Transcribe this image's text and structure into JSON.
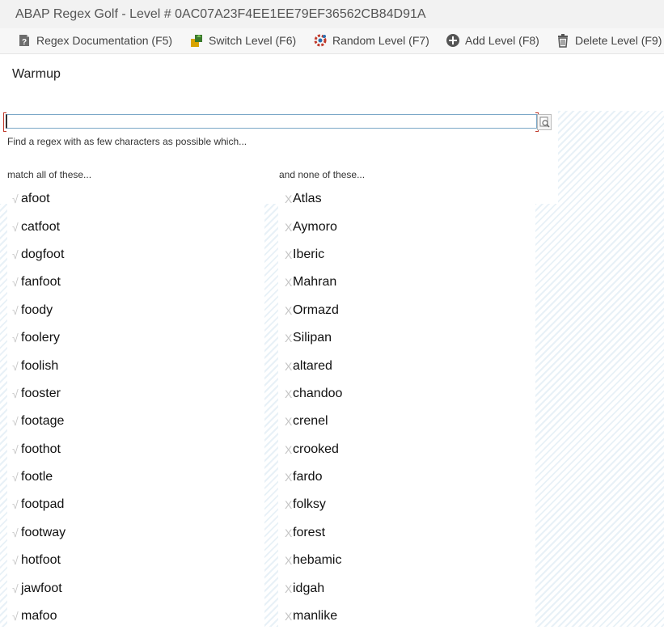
{
  "window": {
    "title": "ABAP Regex Golf - Level # 0AC07A23F4EE1EE79EF36562CB84D91A"
  },
  "toolbar": {
    "buttons": [
      {
        "label": "Regex Documentation (F5)",
        "icon": "document-question-icon"
      },
      {
        "label": "Switch Level (F6)",
        "icon": "switch-level-icon"
      },
      {
        "label": "Random Level (F7)",
        "icon": "random-gear-icon"
      },
      {
        "label": "Add Level (F8)",
        "icon": "plus-circle-icon"
      },
      {
        "label": "Delete Level (F9)",
        "icon": "trash-icon"
      }
    ]
  },
  "level": {
    "name": "Warmup"
  },
  "regex": {
    "value": "",
    "hint": "Find a regex with as few characters as possible which..."
  },
  "match_list": {
    "header": "match all of these...",
    "mark": "√",
    "items": [
      "afoot",
      "catfoot",
      "dogfoot",
      "fanfoot",
      "foody",
      "foolery",
      "foolish",
      "fooster",
      "footage",
      "foothot",
      "footle",
      "footpad",
      "footway",
      "hotfoot",
      "jawfoot",
      "mafoo"
    ]
  },
  "none_list": {
    "header": "and none of these...",
    "mark": "X",
    "items": [
      "Atlas",
      "Aymoro",
      "Iberic",
      "Mahran",
      "Ormazd",
      "Silipan",
      "altared",
      "chandoo",
      "crenel",
      "crooked",
      "fardo",
      "folksy",
      "forest",
      "hebamic",
      "idgah",
      "manlike"
    ]
  },
  "colors": {
    "input_border": "#7aa7c7",
    "focus_corners": "#c0392b",
    "hatch": "#e8f1f7",
    "mark": "#c4c4c4"
  }
}
